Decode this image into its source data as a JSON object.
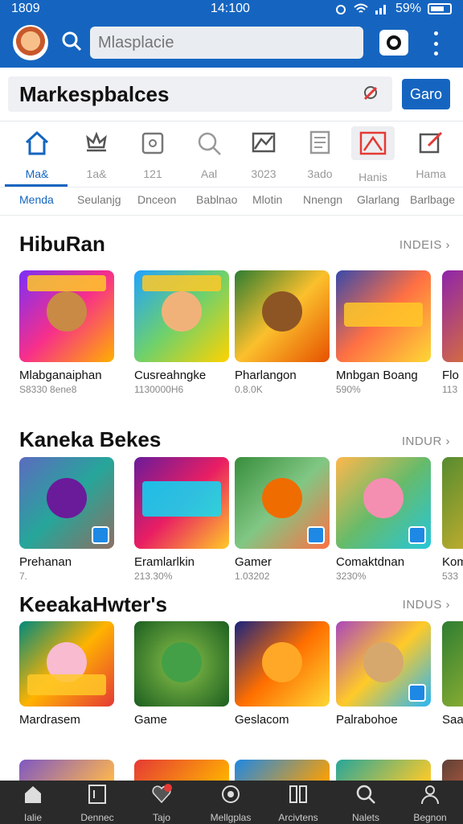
{
  "status_bar": {
    "time_left": "1809",
    "time_center": "14:100",
    "battery": "59%"
  },
  "app_bar": {
    "search_placeholder": "Mlasplacie",
    "search_icon": "search-icon",
    "camera_icon": "camera-icon",
    "more_icon": "more-vertical-icon"
  },
  "title_bar": {
    "title": "Markespbalces",
    "icon": "pin-icon",
    "button_label": "Garo"
  },
  "category_nav": [
    {
      "label": "Ma&",
      "icon": "home-icon",
      "active": true
    },
    {
      "label": "1a&",
      "icon": "crown-icon",
      "active": false
    },
    {
      "label": "121",
      "icon": "gamepad-icon",
      "active": false
    },
    {
      "label": "Aal",
      "icon": "search-icon",
      "active": false
    },
    {
      "label": "3023",
      "icon": "flag-icon",
      "active": false
    },
    {
      "label": "3ado",
      "icon": "document-icon",
      "active": false
    },
    {
      "label": "Hanis",
      "icon": "image-icon",
      "active": false
    },
    {
      "label": "Hama",
      "icon": "edit-icon",
      "active": false
    }
  ],
  "sub_tabs": [
    "Menda",
    "Seulanjg",
    "Dnceon",
    "Bablnao",
    "Mlotin",
    "Nnengn",
    "Glarlang",
    "Barlbage"
  ],
  "sections": [
    {
      "title": "HibuRan",
      "more": "INDEIS",
      "cards": [
        {
          "name": "Mlabganaiphan",
          "meta": "S8330 8ene8"
        },
        {
          "name": "Cusreahngke",
          "meta": "1130000H6"
        },
        {
          "name": "Pharlangon",
          "meta": "0.8.0K"
        },
        {
          "name": "Mnbgan Boang",
          "meta": "590%"
        },
        {
          "name": "Flo",
          "meta": "113"
        }
      ]
    },
    {
      "title": "Kaneka Bekes",
      "more": "INDUR",
      "cards": [
        {
          "name": "Prehanan",
          "meta": "7."
        },
        {
          "name": "Eramlarlkin",
          "meta": "213.30%"
        },
        {
          "name": "Gamer",
          "meta": "1.03202"
        },
        {
          "name": "Comaktdnan",
          "meta": "3230%"
        },
        {
          "name": "Kom",
          "meta": "533"
        }
      ]
    },
    {
      "title": "KeeakaHwter's",
      "more": "INDUS",
      "cards": [
        {
          "name": "Mardrasem",
          "meta": ""
        },
        {
          "name": "Game",
          "meta": ""
        },
        {
          "name": "Geslacom",
          "meta": ""
        },
        {
          "name": "Palrabohoe",
          "meta": ""
        },
        {
          "name": "Saa",
          "meta": ""
        }
      ]
    }
  ],
  "bottom_nav": [
    {
      "label": "Ialie",
      "icon": "home-icon"
    },
    {
      "label": "Dennec",
      "icon": "tablet-icon"
    },
    {
      "label": "Tajo",
      "icon": "heart-icon",
      "badge": true
    },
    {
      "label": "Mellgplas",
      "icon": "target-icon"
    },
    {
      "label": "Arcivtens",
      "icon": "grid-icon"
    },
    {
      "label": "Nalets",
      "icon": "search-icon"
    },
    {
      "label": "Begnon",
      "icon": "user-icon"
    }
  ],
  "colors": {
    "primary": "#1565c0",
    "bottom_bar": "#2a2a2a"
  }
}
